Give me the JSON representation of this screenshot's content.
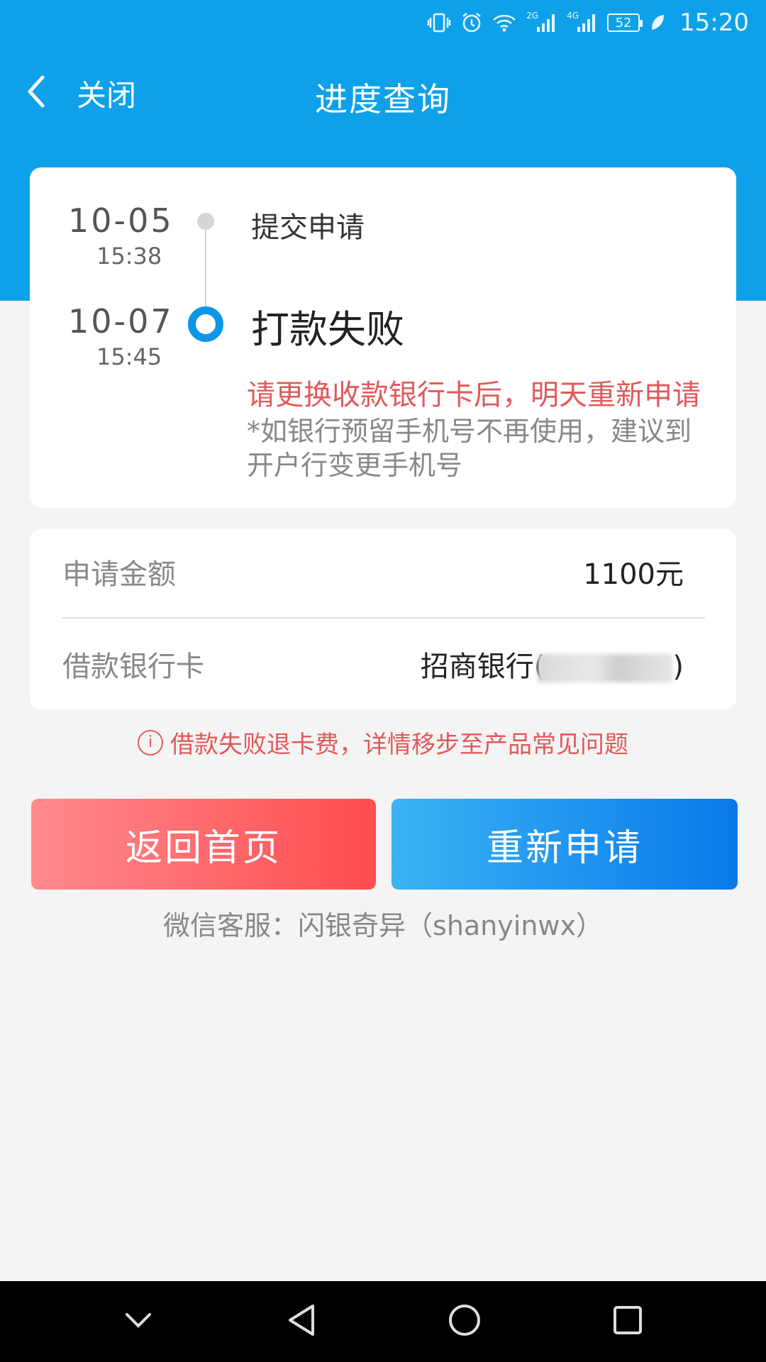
{
  "status_bar": {
    "net1": "2G",
    "net2": "4G",
    "battery": "52",
    "time": "15:20"
  },
  "header": {
    "close_label": "关闭",
    "title": "进度查询"
  },
  "timeline": {
    "steps": [
      {
        "date": "10-05",
        "time": "15:38",
        "label": "提交申请"
      },
      {
        "date": "10-07",
        "time": "15:45",
        "label": "打款失败"
      }
    ],
    "warning": "请更换收款银行卡后，明天重新申请",
    "note": "*如银行预留手机号不再使用，建议到开户行变更手机号"
  },
  "info": {
    "amount_label": "申请金额",
    "amount_value": "1100元",
    "card_label": "借款银行卡",
    "card_value_prefix": "招商银行(",
    "card_value_suffix": ")"
  },
  "notice": "借款失败退卡费，详情移步至产品常见问题",
  "buttons": {
    "home": "返回首页",
    "reapply": "重新申请"
  },
  "wechat_service": "微信客服：闪银奇异（shanyinwx）",
  "colors": {
    "primary_blue": "#0ea1ea",
    "warning_red": "#e05a5a"
  }
}
